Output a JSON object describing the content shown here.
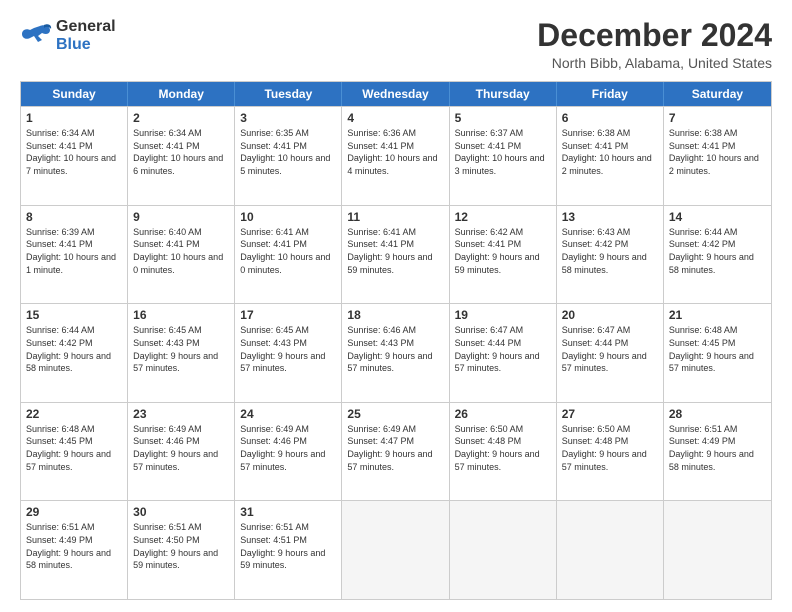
{
  "logo": {
    "line1": "General",
    "line2": "Blue"
  },
  "title": "December 2024",
  "subtitle": "North Bibb, Alabama, United States",
  "header_days": [
    "Sunday",
    "Monday",
    "Tuesday",
    "Wednesday",
    "Thursday",
    "Friday",
    "Saturday"
  ],
  "rows": [
    [
      {
        "day": "1",
        "rise": "6:34 AM",
        "set": "4:41 PM",
        "daylight": "10 hours and 7 minutes."
      },
      {
        "day": "2",
        "rise": "6:34 AM",
        "set": "4:41 PM",
        "daylight": "10 hours and 6 minutes."
      },
      {
        "day": "3",
        "rise": "6:35 AM",
        "set": "4:41 PM",
        "daylight": "10 hours and 5 minutes."
      },
      {
        "day": "4",
        "rise": "6:36 AM",
        "set": "4:41 PM",
        "daylight": "10 hours and 4 minutes."
      },
      {
        "day": "5",
        "rise": "6:37 AM",
        "set": "4:41 PM",
        "daylight": "10 hours and 3 minutes."
      },
      {
        "day": "6",
        "rise": "6:38 AM",
        "set": "4:41 PM",
        "daylight": "10 hours and 2 minutes."
      },
      {
        "day": "7",
        "rise": "6:38 AM",
        "set": "4:41 PM",
        "daylight": "10 hours and 2 minutes."
      }
    ],
    [
      {
        "day": "8",
        "rise": "6:39 AM",
        "set": "4:41 PM",
        "daylight": "10 hours and 1 minute."
      },
      {
        "day": "9",
        "rise": "6:40 AM",
        "set": "4:41 PM",
        "daylight": "10 hours and 0 minutes."
      },
      {
        "day": "10",
        "rise": "6:41 AM",
        "set": "4:41 PM",
        "daylight": "10 hours and 0 minutes."
      },
      {
        "day": "11",
        "rise": "6:41 AM",
        "set": "4:41 PM",
        "daylight": "9 hours and 59 minutes."
      },
      {
        "day": "12",
        "rise": "6:42 AM",
        "set": "4:41 PM",
        "daylight": "9 hours and 59 minutes."
      },
      {
        "day": "13",
        "rise": "6:43 AM",
        "set": "4:42 PM",
        "daylight": "9 hours and 58 minutes."
      },
      {
        "day": "14",
        "rise": "6:44 AM",
        "set": "4:42 PM",
        "daylight": "9 hours and 58 minutes."
      }
    ],
    [
      {
        "day": "15",
        "rise": "6:44 AM",
        "set": "4:42 PM",
        "daylight": "9 hours and 58 minutes."
      },
      {
        "day": "16",
        "rise": "6:45 AM",
        "set": "4:43 PM",
        "daylight": "9 hours and 57 minutes."
      },
      {
        "day": "17",
        "rise": "6:45 AM",
        "set": "4:43 PM",
        "daylight": "9 hours and 57 minutes."
      },
      {
        "day": "18",
        "rise": "6:46 AM",
        "set": "4:43 PM",
        "daylight": "9 hours and 57 minutes."
      },
      {
        "day": "19",
        "rise": "6:47 AM",
        "set": "4:44 PM",
        "daylight": "9 hours and 57 minutes."
      },
      {
        "day": "20",
        "rise": "6:47 AM",
        "set": "4:44 PM",
        "daylight": "9 hours and 57 minutes."
      },
      {
        "day": "21",
        "rise": "6:48 AM",
        "set": "4:45 PM",
        "daylight": "9 hours and 57 minutes."
      }
    ],
    [
      {
        "day": "22",
        "rise": "6:48 AM",
        "set": "4:45 PM",
        "daylight": "9 hours and 57 minutes."
      },
      {
        "day": "23",
        "rise": "6:49 AM",
        "set": "4:46 PM",
        "daylight": "9 hours and 57 minutes."
      },
      {
        "day": "24",
        "rise": "6:49 AM",
        "set": "4:46 PM",
        "daylight": "9 hours and 57 minutes."
      },
      {
        "day": "25",
        "rise": "6:49 AM",
        "set": "4:47 PM",
        "daylight": "9 hours and 57 minutes."
      },
      {
        "day": "26",
        "rise": "6:50 AM",
        "set": "4:48 PM",
        "daylight": "9 hours and 57 minutes."
      },
      {
        "day": "27",
        "rise": "6:50 AM",
        "set": "4:48 PM",
        "daylight": "9 hours and 57 minutes."
      },
      {
        "day": "28",
        "rise": "6:51 AM",
        "set": "4:49 PM",
        "daylight": "9 hours and 58 minutes."
      }
    ],
    [
      {
        "day": "29",
        "rise": "6:51 AM",
        "set": "4:49 PM",
        "daylight": "9 hours and 58 minutes."
      },
      {
        "day": "30",
        "rise": "6:51 AM",
        "set": "4:50 PM",
        "daylight": "9 hours and 59 minutes."
      },
      {
        "day": "31",
        "rise": "6:51 AM",
        "set": "4:51 PM",
        "daylight": "9 hours and 59 minutes."
      },
      null,
      null,
      null,
      null
    ]
  ]
}
